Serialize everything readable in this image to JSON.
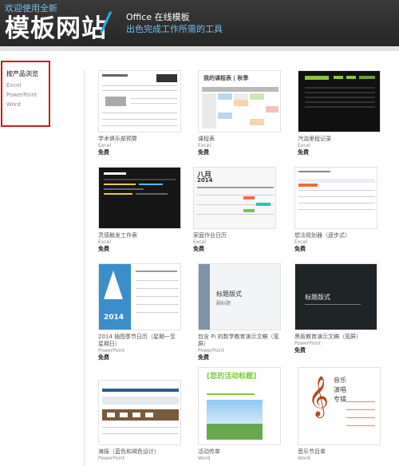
{
  "header": {
    "welcome": "欢迎使用全新",
    "brand": "模板网站",
    "office": "Office 在线模板",
    "tagline": "出色完成工作所需的工具"
  },
  "sidebar": {
    "title": "按产品浏览",
    "items": [
      "Excel",
      "PowerPoint",
      "Word"
    ]
  },
  "templates": [
    {
      "name": "学术俱乐部预算",
      "product": "Excel",
      "price": "免费"
    },
    {
      "name": "课程表",
      "product": "Excel",
      "price": "免费",
      "thumb_title": "我的课程表 | 秋季"
    },
    {
      "name": "汽油里程记录",
      "product": "Excel",
      "price": "免费"
    },
    {
      "name": "灵感触发工作表",
      "product": "Excel",
      "price": "免费"
    },
    {
      "name": "家庭作业日历",
      "product": "Excel",
      "price": "免费",
      "thumb_month": "八月",
      "thumb_year": "2014"
    },
    {
      "name": "想法规划器（逐步式）",
      "product": "Excel",
      "price": "免费"
    },
    {
      "name": "2014 插图季节日历（星期一至星期日）",
      "product": "PowerPoint",
      "price": "免费",
      "thumb_year": "2014"
    },
    {
      "name": "包含 Pi 的数学教育演示文稿（宽屏）",
      "product": "PowerPoint",
      "price": "免费",
      "thumb_title": "标题版式",
      "thumb_sub": "副标题"
    },
    {
      "name": "黑板教育演示文稿（宽屏）",
      "product": "PowerPoint",
      "price": "免费",
      "thumb_title": "标题版式"
    },
    {
      "name": "海报（蓝色和褐色设计）",
      "product": "PowerPoint",
      "price": ""
    },
    {
      "name": "活动传单",
      "product": "Word",
      "price": "",
      "thumb_title": "[您的活动标题]"
    },
    {
      "name": "音乐节目单",
      "product": "Word",
      "price": "",
      "thumb_title": "音乐 演唱 专辑"
    }
  ],
  "colors": {
    "header_bg": "#2e2e2e",
    "accent_blue": "#27a9e1",
    "sidebar_border": "#cc1a1a",
    "green": "#8cc63f"
  }
}
